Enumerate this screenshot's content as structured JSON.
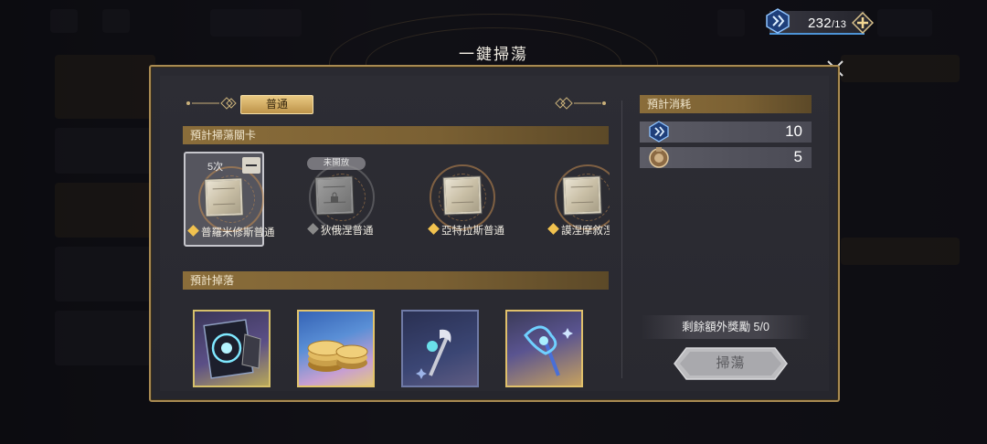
{
  "header": {
    "title": "一鍵掃蕩",
    "currency_main": "232",
    "currency_cap": "/13"
  },
  "tabs": [
    {
      "label": "普通",
      "active": true
    }
  ],
  "stages_section": {
    "title": "預計掃蕩關卡",
    "items": [
      {
        "name": "普羅米修斯普通",
        "count": "5次",
        "selected": true,
        "locked": false
      },
      {
        "name": "狄俄涅普通",
        "lock_label": "未開放",
        "locked": true
      },
      {
        "name": "亞特拉斯普通",
        "locked": false
      },
      {
        "name": "謨涅摩敘涅普通",
        "locked": false
      }
    ]
  },
  "drops_section": {
    "title": "預計掉落",
    "items": [
      {
        "icon": "purple-relic-card"
      },
      {
        "icon": "gold-coins"
      },
      {
        "icon": "silver-wand"
      },
      {
        "icon": "blue-wand"
      }
    ]
  },
  "cost_section": {
    "title": "預計消耗",
    "items": [
      {
        "icon": "stamina-icon",
        "value": "10"
      },
      {
        "icon": "sweep-ticket-icon",
        "value": "5"
      }
    ]
  },
  "bonus": {
    "text": "剩餘額外獎勵  5/0"
  },
  "sweep_button": {
    "label": "掃蕩",
    "enabled": false
  },
  "colors": {
    "accent_gold": "#e9c982",
    "panel_border": "#a88a52",
    "currency_bar": "#4d93d6"
  }
}
